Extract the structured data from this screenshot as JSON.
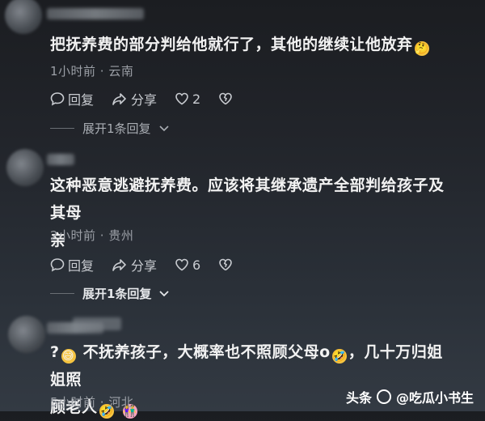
{
  "comments": [
    {
      "text": "把抚养费的部分判给他就行了，其他的继续让他放弃",
      "emoji_end": "think-emoji",
      "meta": "1小时前 · 云南",
      "reply_label": "回复",
      "share_label": "分享",
      "likes": "2",
      "replies_label": "展开1条回复"
    },
    {
      "text_line1": "这种恶意逃避抚养费。应该将其继承遗产全部判给孩子及其母",
      "text_line2": "亲",
      "meta": "2小时前 · 贵州",
      "reply_label": "回复",
      "share_label": "分享",
      "likes": "6",
      "replies_label": "展开1条回复"
    },
    {
      "text_line1_a": "?",
      "text_line1_b": "不抚养孩子，大概率也不照顾父母o",
      "text_line1_c": "，几十万归姐姐照",
      "text_line2": "顾老人",
      "meta": "5小时前 · 河北"
    }
  ],
  "watermark": {
    "brand": "头条",
    "handle": "@吃瓜小书生"
  },
  "colors": {
    "text": "#f2f2f2",
    "meta": "#9b9fa6",
    "action": "#c9ccd1",
    "emoji": "#f6c440"
  }
}
